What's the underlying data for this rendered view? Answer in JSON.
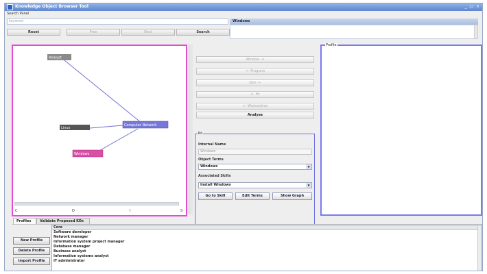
{
  "window": {
    "title": "Knowledge Object Browser Tool",
    "controls": "_ □ ×"
  },
  "search": {
    "panel_label": "Search Panel",
    "input_placeholder": "keyword",
    "buttons": [
      "Reset",
      "Prev",
      "Next",
      "Search"
    ]
  },
  "windows_panel": {
    "header": "Windows"
  },
  "graph": {
    "nodes": [
      {
        "label": "Analyst",
        "fill": "#8a8a8a"
      },
      {
        "label": "Linux",
        "fill": "#555555"
      },
      {
        "label": "Computer Network",
        "fill": "#7878d8"
      },
      {
        "label": "Windows",
        "fill": "#d94fa6"
      }
    ],
    "axis": [
      "C",
      "D",
      "I",
      "S"
    ]
  },
  "navigation": {
    "buttons": [
      "Window ->",
      "<- Program",
      "Dev ->",
      "<- Hr",
      "<- Workstation"
    ],
    "analyse": "Analyse"
  },
  "kn_panel": {
    "legend": "Kn",
    "internal_name_label": "Internal Name",
    "internal_name_value": "Windows",
    "object_terms_label": "Object Terms",
    "object_terms_value": "Windows",
    "associated_skills_label": "Associated Skills",
    "associated_skills_value": "Install Windows",
    "buttons": [
      "Go to Skill",
      "Edit Terms",
      "Show Graph"
    ]
  },
  "profile_panel": {
    "legend": "Profile"
  },
  "tabs": [
    "Profiles",
    "Validate Proposed KOs"
  ],
  "profiles": {
    "buttons": [
      "New Profile",
      "Delete Profile",
      "Import Profile"
    ],
    "column": "Core",
    "items": [
      "Software developer",
      "Network manager",
      "Information system project manager",
      "Database manager",
      "Business analyst",
      "Information systems analyst",
      "IT administrator"
    ]
  },
  "colors": {
    "accent": "#e24cd0",
    "panel_border": "#7a7af0",
    "title_bar": "#5d86cf"
  }
}
